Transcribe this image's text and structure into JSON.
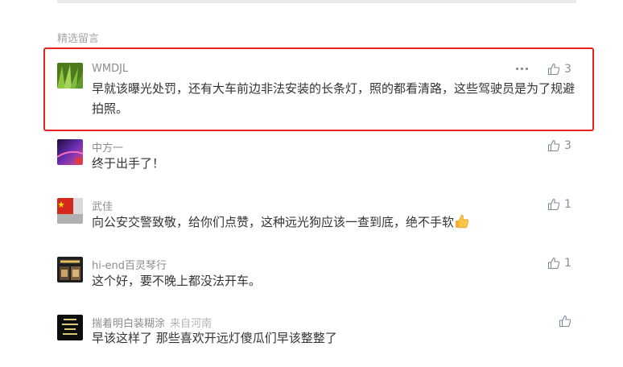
{
  "section_title": "精选留言",
  "comments": [
    {
      "nickname": "WMDJL",
      "location": "",
      "text": "早就该曝光处罚，还有大车前边非法安装的长条灯，照的都看清路，这些驾驶员是为了规避拍照。",
      "likes": "3",
      "highlighted": true,
      "has_more_menu": true,
      "avatar": "green-leaf-avatar"
    },
    {
      "nickname": "中方一",
      "location": "",
      "text": "终于出手了！",
      "likes": "3",
      "avatar": "purple-gradient-avatar"
    },
    {
      "nickname": "武佳",
      "location": "",
      "text": "向公安交警致敬，给你们点赞，这种远光狗应该一查到底，绝不手软",
      "likes": "1",
      "emoji": "thumbs-up-emoji",
      "avatar": "china-flag-avatar"
    },
    {
      "nickname": "hi-end百灵琴行",
      "location": "",
      "text": "这个好，要不晚上都没法开车。",
      "likes": "1",
      "avatar": "piano-store-avatar"
    },
    {
      "nickname": "揣着明白装糊涂",
      "location": "来自河南",
      "text": "早该这样了  那些喜欢开远灯傻瓜们早该整整了",
      "likes": "",
      "avatar": "black-text-avatar"
    }
  ],
  "colors": {
    "highlight_border": "#e8221e",
    "nickname": "#8c8c8c",
    "text": "#333333",
    "section_title": "#a6a6a6"
  }
}
